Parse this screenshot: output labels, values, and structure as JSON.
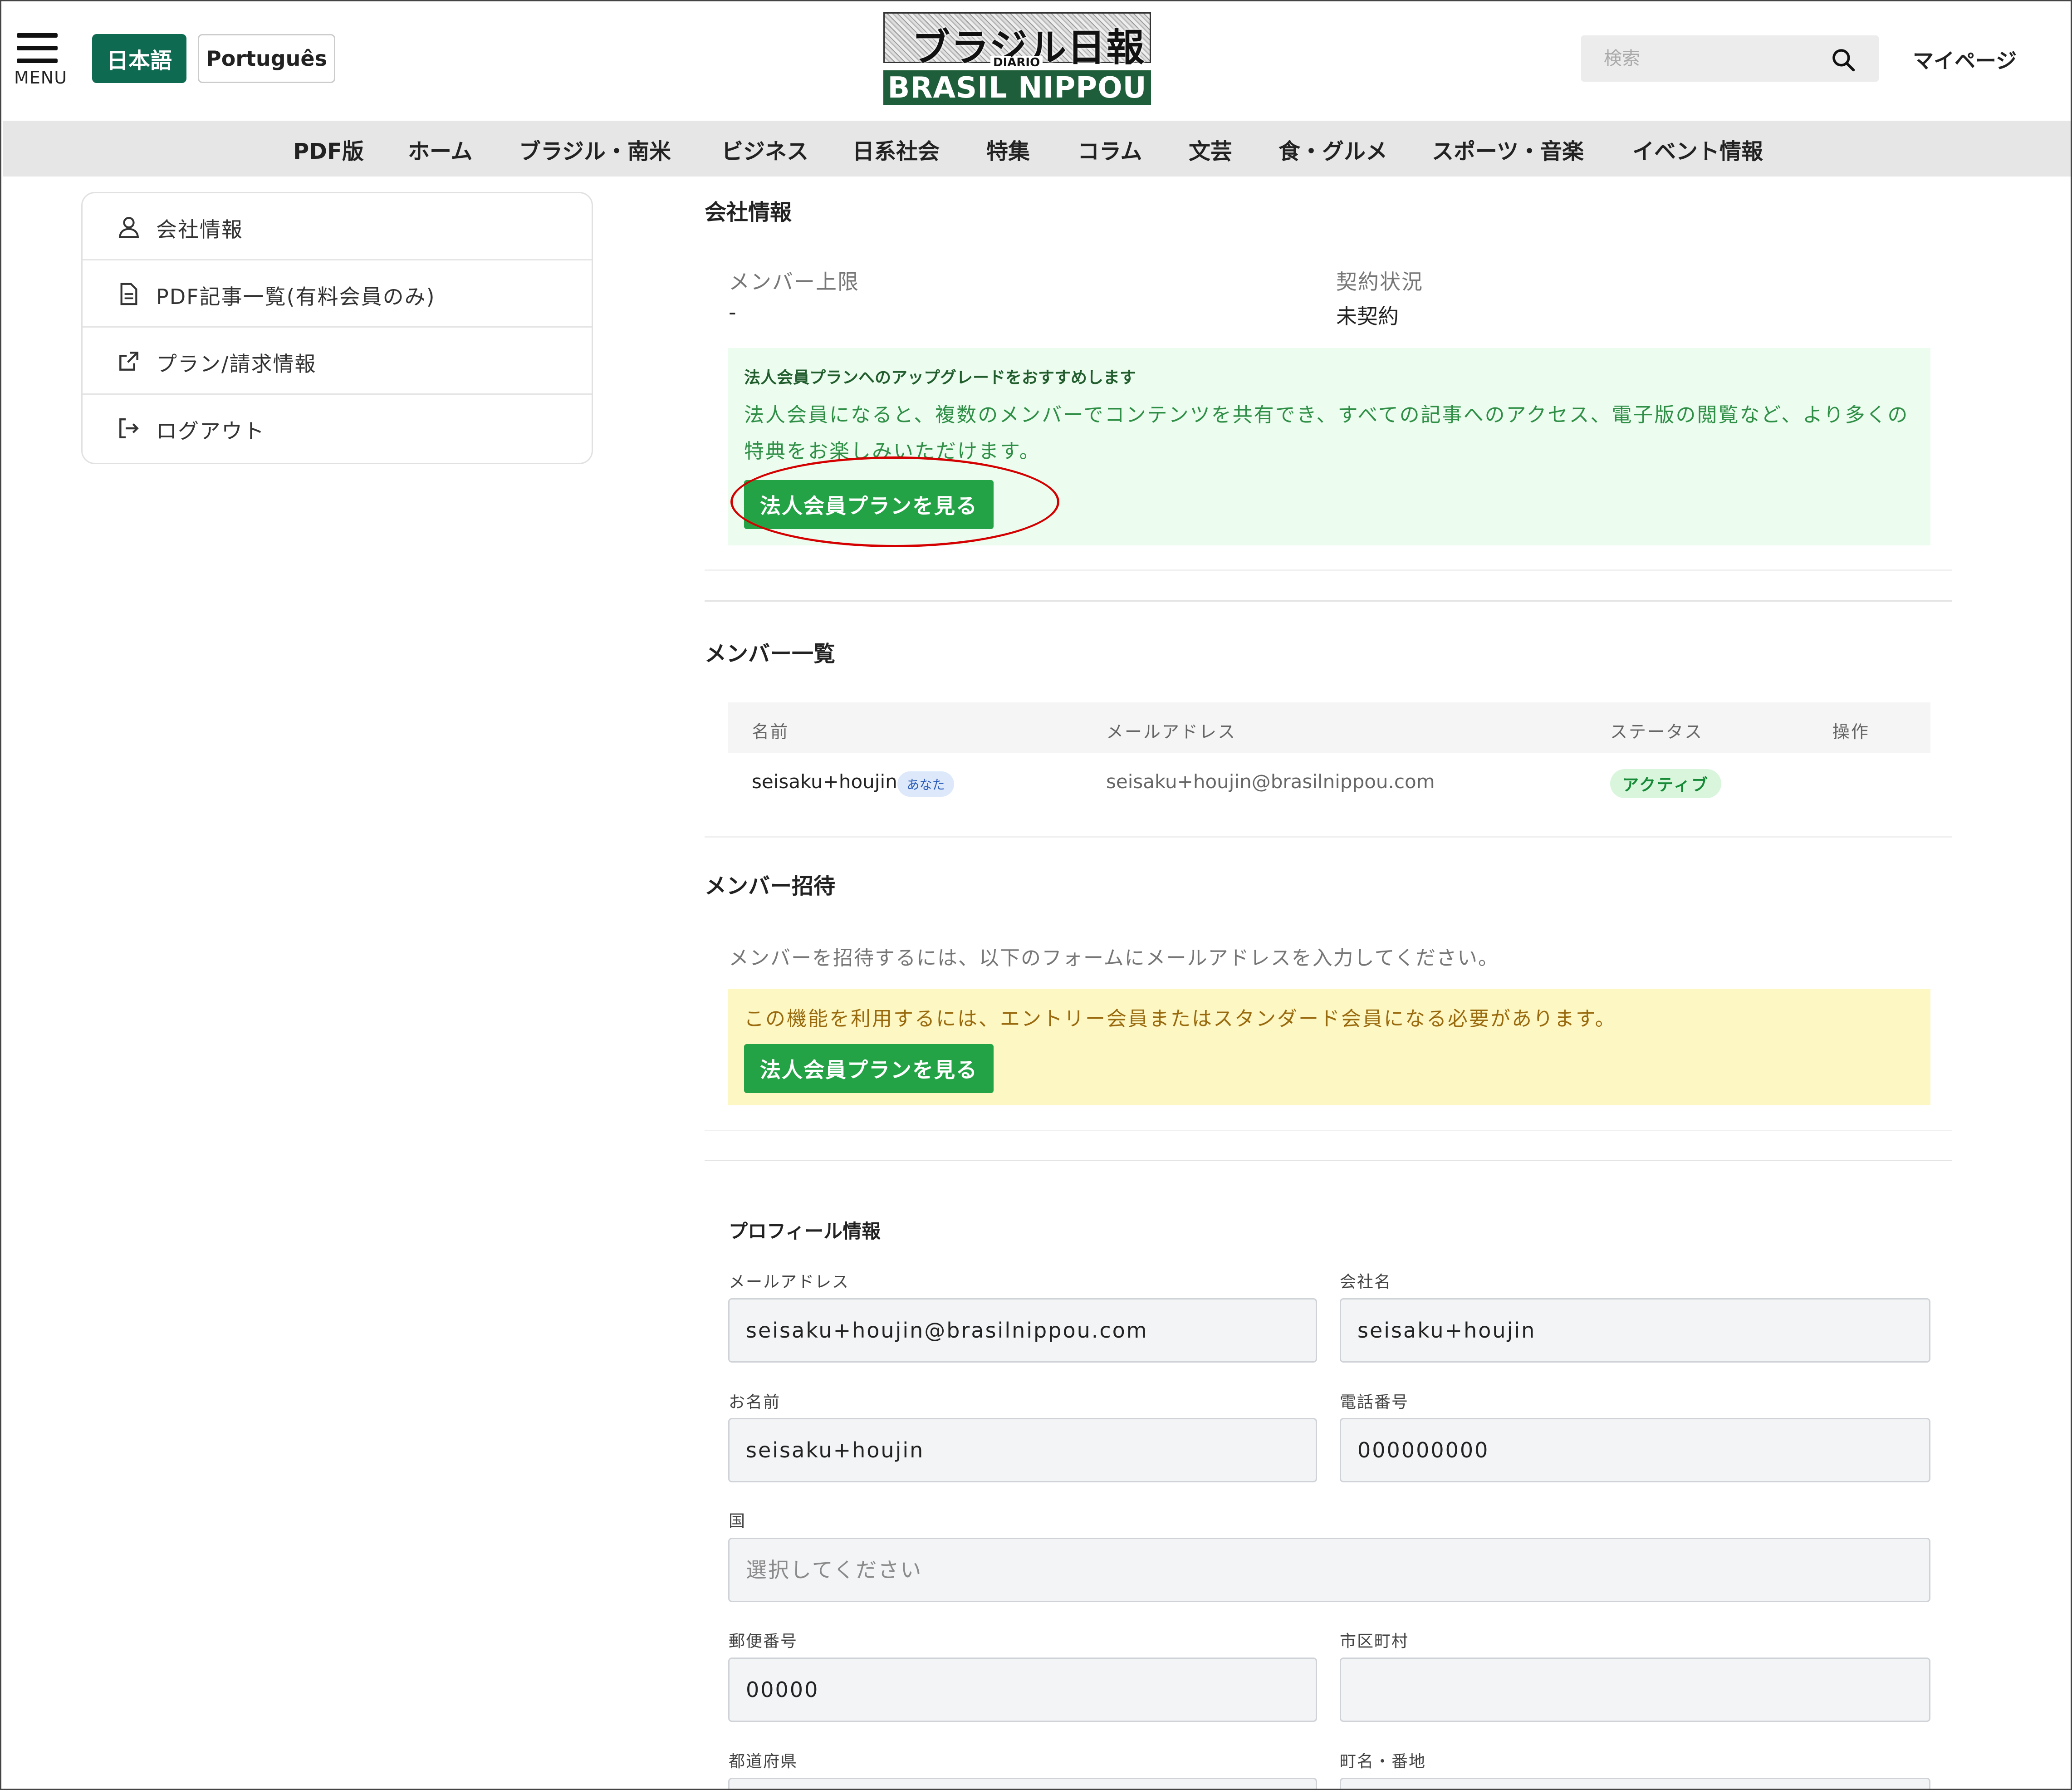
{
  "header": {
    "menu_label": "MENU",
    "lang_ja": "日本語",
    "lang_pt": "Português",
    "logo_ja": "ブラジル日報",
    "logo_diario": "DIÁRIO",
    "logo_en": "BRASIL NIPPOU",
    "search_placeholder": "検索",
    "mypage": "マイページ"
  },
  "nav": {
    "items": [
      "PDF版",
      "ホーム",
      "ブラジル・南米",
      "ビジネス",
      "日系社会",
      "特集",
      "コラム",
      "文芸",
      "食・グルメ",
      "スポーツ・音楽",
      "イベント情報"
    ]
  },
  "sidebar": {
    "items": [
      {
        "label": "会社情報",
        "icon": "user-icon"
      },
      {
        "label": "PDF記事一覧(有料会員のみ)",
        "icon": "document-icon"
      },
      {
        "label": "プラン/請求情報",
        "icon": "external-link-icon"
      },
      {
        "label": "ログアウト",
        "icon": "logout-icon"
      }
    ]
  },
  "company": {
    "title": "会社情報",
    "member_limit_label": "メンバー上限",
    "member_limit_value": "-",
    "contract_label": "契約状況",
    "contract_value": "未契約",
    "upgrade_head": "法人会員プランへのアップグレードをおすすめします",
    "upgrade_body": "法人会員になると、複数のメンバーでコンテンツを共有でき、すべての記事へのアクセス、電子版の閲覧など、より多くの特典をお楽しみいただけます。",
    "upgrade_button": "法人会員プランを見る"
  },
  "members": {
    "title": "メンバー一覧",
    "columns": [
      "名前",
      "メールアドレス",
      "ステータス",
      "操作"
    ],
    "rows": [
      {
        "name": "seisaku+houjin",
        "badge": "あなた",
        "email": "seisaku+houjin@brasilnippou.com",
        "status": "アクティブ"
      }
    ]
  },
  "invite": {
    "title": "メンバー招待",
    "description": "メンバーを招待するには、以下のフォームにメールアドレスを入力してください。",
    "notice": "この機能を利用するには、エントリー会員またはスタンダード会員になる必要があります。",
    "button": "法人会員プランを見る"
  },
  "profile": {
    "title": "プロフィール情報",
    "email_label": "メールアドレス",
    "email_value": "seisaku+houjin@brasilnippou.com",
    "company_label": "会社名",
    "company_value": "seisaku+houjin",
    "name_label": "お名前",
    "name_value": "seisaku+houjin",
    "phone_label": "電話番号",
    "phone_value": "000000000",
    "country_label": "国",
    "country_placeholder": "選択してください",
    "postal_label": "郵便番号",
    "postal_value": "00000",
    "city_label": "市区町村",
    "city_value": "",
    "prefecture_label": "都道府県",
    "address_label": "町名・番地"
  },
  "colors": {
    "brand_green": "#0f6a52",
    "button_green": "#23a346",
    "highlight_red": "#d40000",
    "notice_yellow": "#fdf8c3",
    "notice_green": "#ecfcef"
  }
}
